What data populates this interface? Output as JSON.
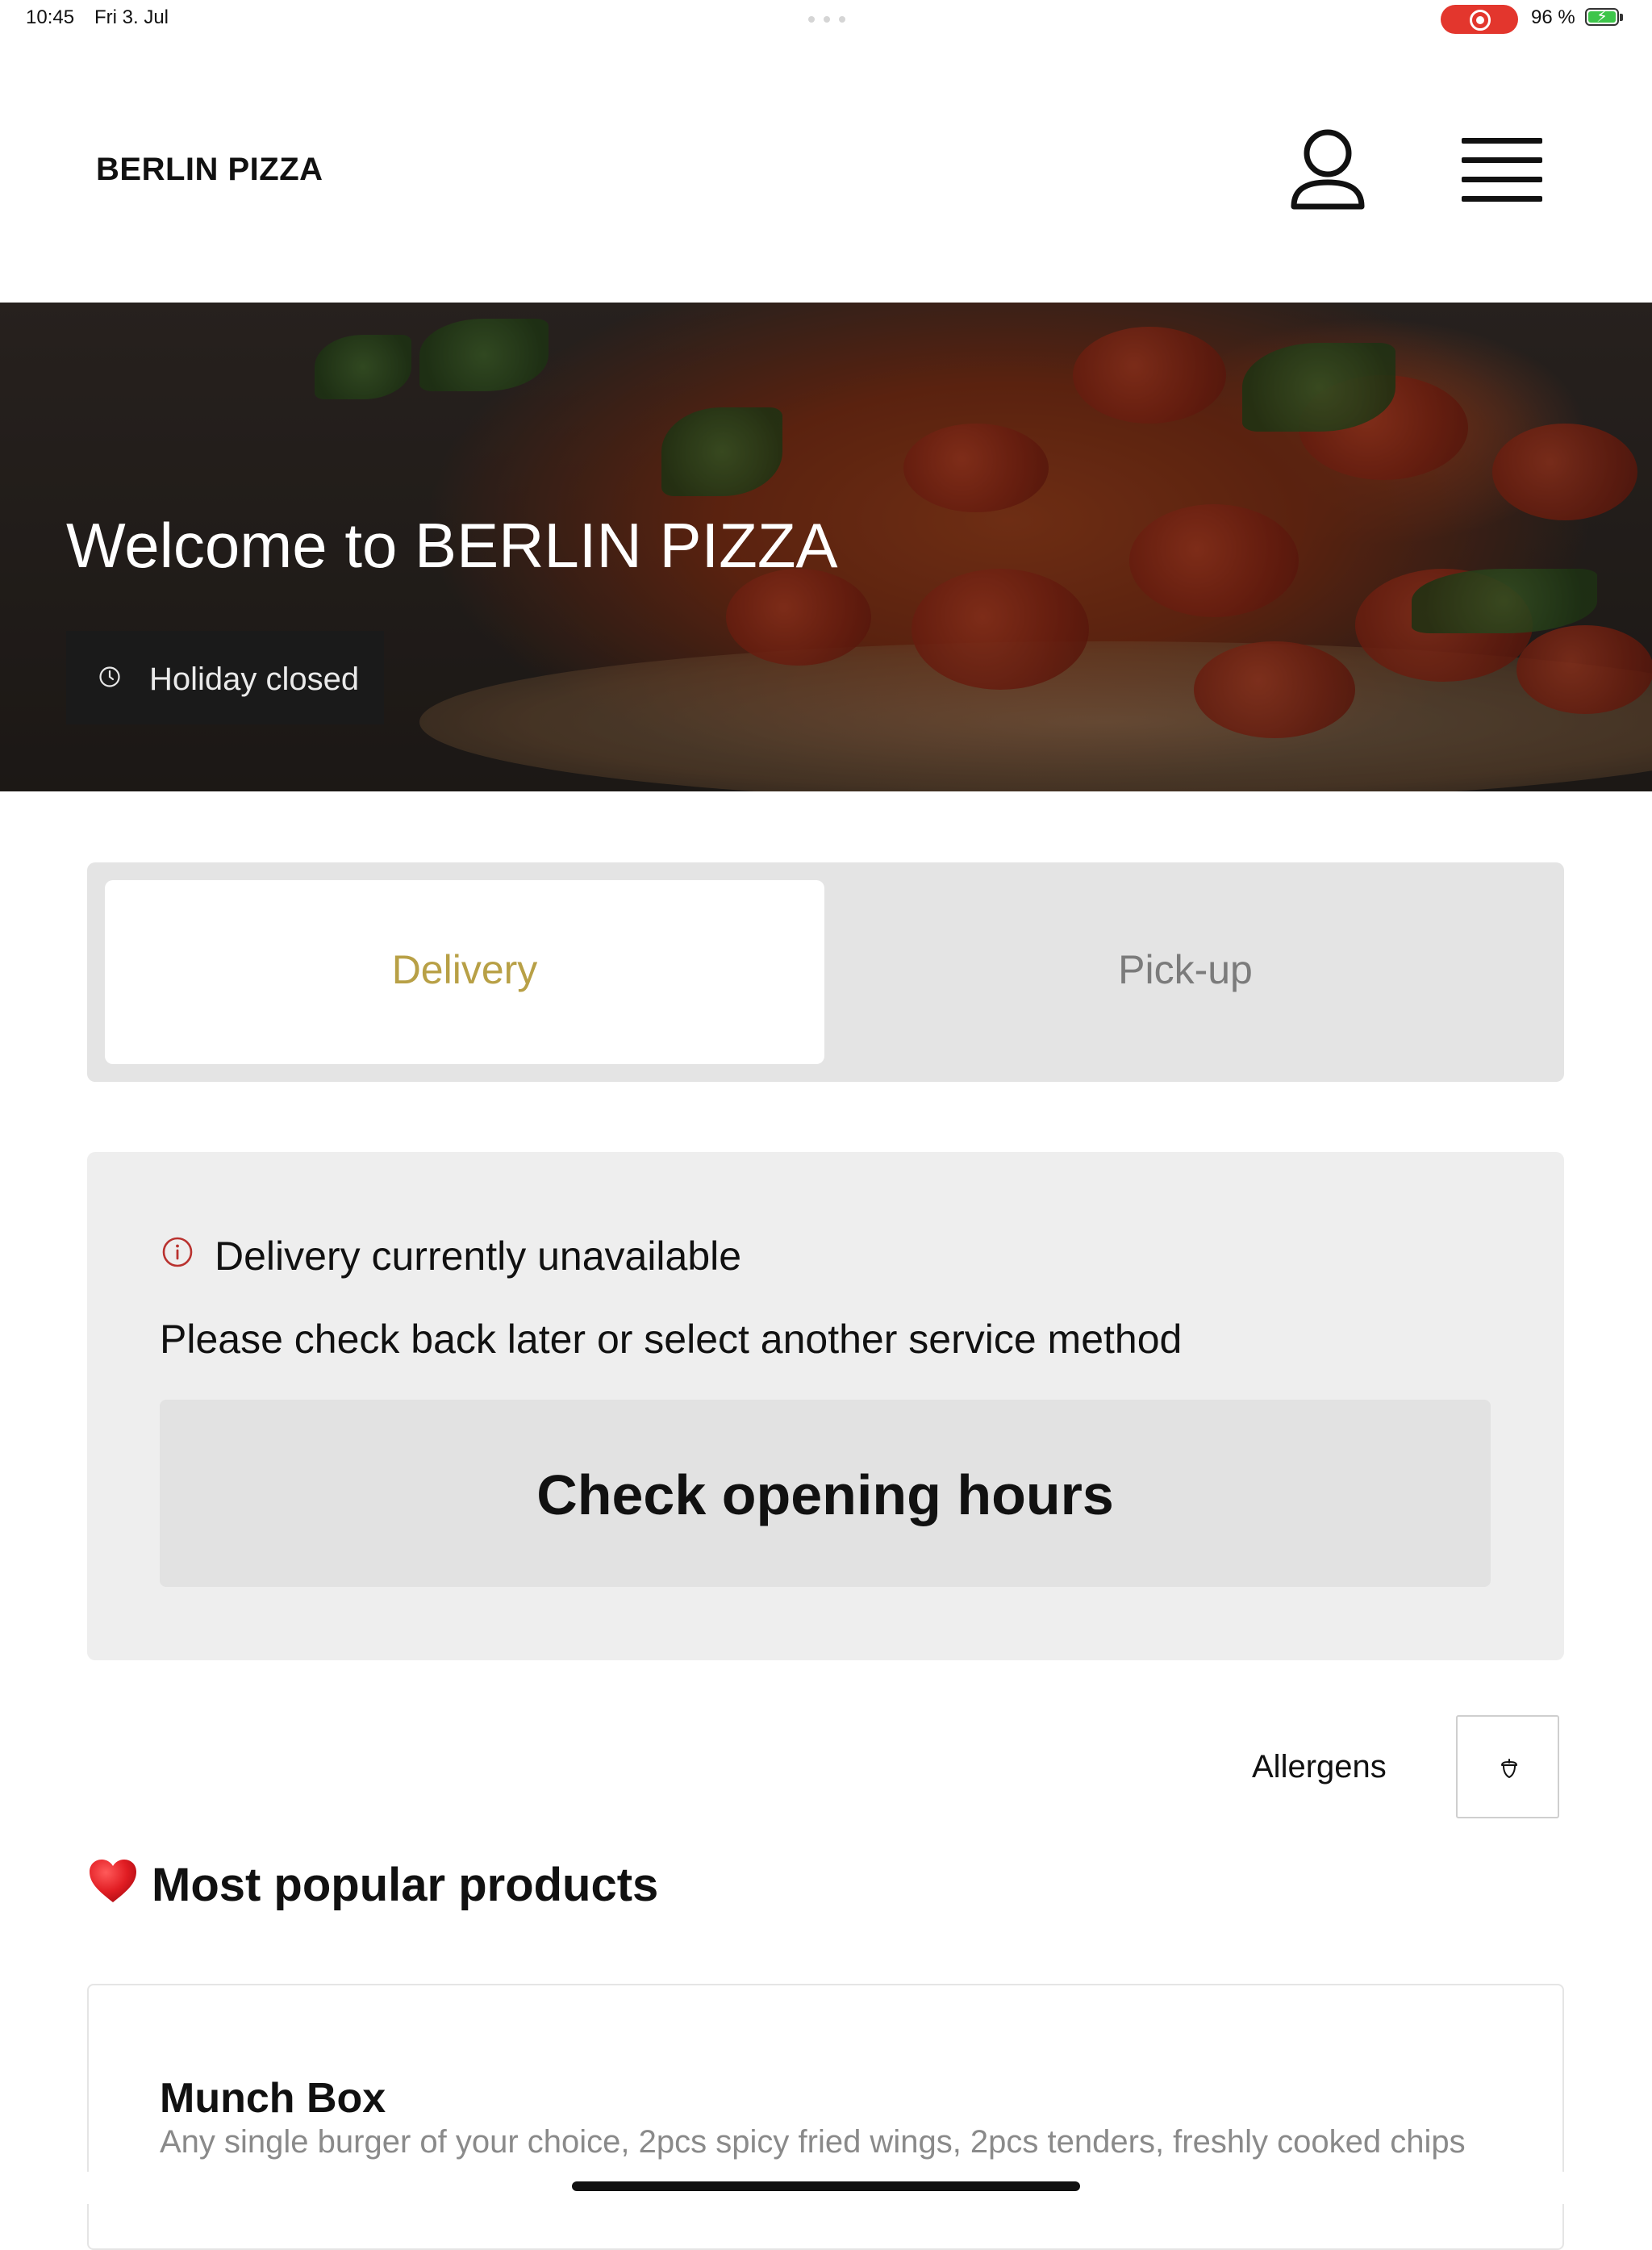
{
  "status_bar": {
    "time": "10:45",
    "date": "Fri 3. Jul",
    "battery": "96 %"
  },
  "header": {
    "brand": "BERLIN PIZZA",
    "user_icon": "user-icon",
    "menu_icon": "hamburger-menu-icon"
  },
  "hero": {
    "title": "Welcome to BERLIN PIZZA",
    "badge_icon": "clock-icon",
    "badge_text": "Holiday closed"
  },
  "service": {
    "options": [
      "Delivery",
      "Pick-up"
    ],
    "selected": "Delivery",
    "accent_color": "#b8a046"
  },
  "notice": {
    "icon": "info-icon",
    "title": "Delivery currently unavailable",
    "description": "Please check back later or select another service method",
    "button": "Check opening hours"
  },
  "allergens": {
    "label": "Allergens",
    "icon": "acorn-icon"
  },
  "popular": {
    "icon": "heart-icon",
    "title": "Most popular products",
    "products": [
      {
        "name": "Munch Box",
        "description": "Any single burger of your choice, 2pcs spicy fried wings, 2pcs tenders, freshly cooked chips"
      }
    ]
  }
}
